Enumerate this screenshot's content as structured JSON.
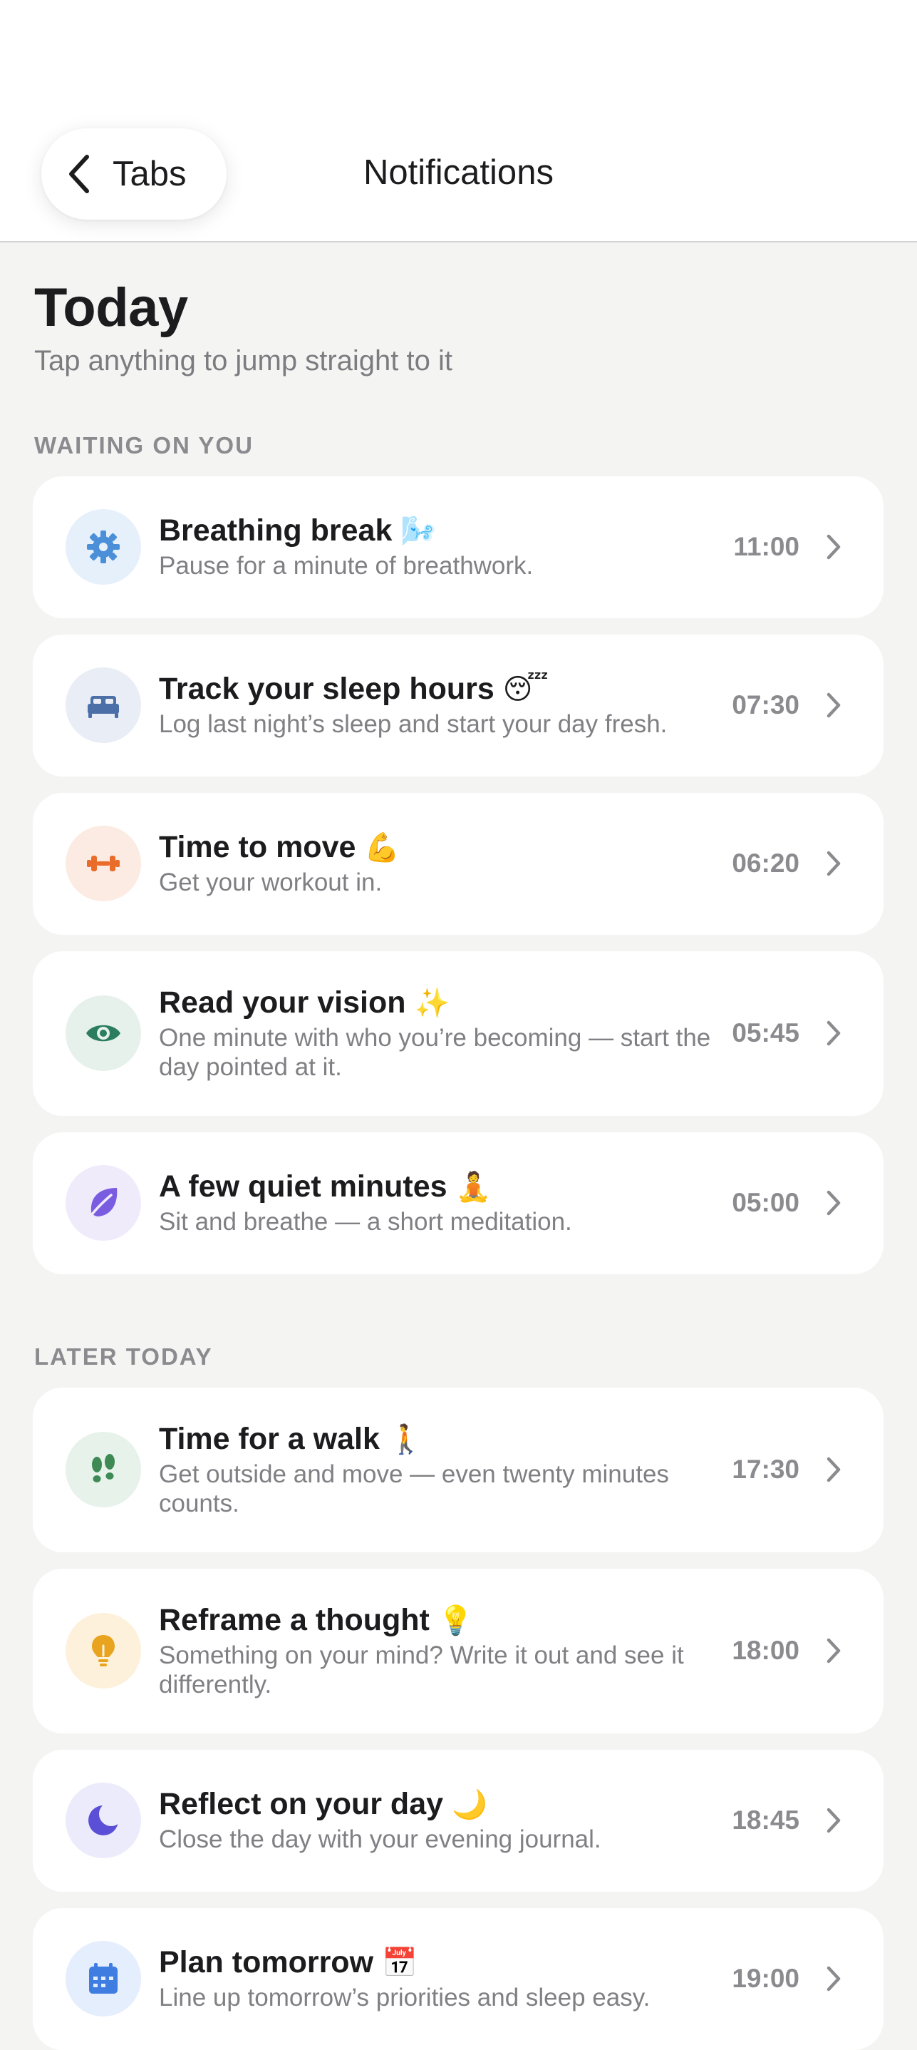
{
  "header": {
    "back_label": "Tabs",
    "title": "Notifications"
  },
  "page": {
    "heading": "Today",
    "subtitle": "Tap anything to jump straight to it"
  },
  "sections": [
    {
      "label": "WAITING ON YOU"
    },
    {
      "label": "LATER TODAY"
    }
  ],
  "colors": {
    "accent_blue": "#4a8fd8",
    "time_gray": "#8b8b8f",
    "background": "#f4f4f3"
  },
  "items": [
    {
      "title": "Breathing break",
      "emoji": "🌬️",
      "desc": "Pause for a minute of breathwork.",
      "time": "11:00",
      "icon": "gear-icon",
      "icon_color": "#4a8fd8",
      "icon_bg": "#e6f0fb"
    },
    {
      "title": "Track your sleep hours",
      "emoji": "😴",
      "desc": "Log last night’s sleep and start your day fresh.",
      "time": "07:30",
      "icon": "bed-icon",
      "icon_color": "#4c6fa8",
      "icon_bg": "#e8edf6"
    },
    {
      "title": "Time to move",
      "emoji": "💪",
      "desc": "Get your workout in.",
      "time": "06:20",
      "icon": "dumbbell-icon",
      "icon_color": "#ea6c2a",
      "icon_bg": "#fcebe2"
    },
    {
      "title": "Read your vision",
      "emoji": "✨",
      "desc": "One minute with who you’re becoming — start the day pointed at it.",
      "time": "05:45",
      "icon": "eye-icon",
      "icon_color": "#2a7d5f",
      "icon_bg": "#e7f1ec"
    },
    {
      "title": "A few quiet minutes",
      "emoji": "🧘",
      "desc": "Sit and breathe — a short meditation.",
      "time": "05:00",
      "icon": "leaf-icon",
      "icon_color": "#7a5ce0",
      "icon_bg": "#efebfb"
    },
    {
      "title": "Time for a walk",
      "emoji": "🚶",
      "desc": "Get outside and move — even twenty minutes counts.",
      "time": "17:30",
      "icon": "footprints-icon",
      "icon_color": "#3e8a55",
      "icon_bg": "#e6f2ea"
    },
    {
      "title": "Reframe a thought",
      "emoji": "💡",
      "desc": "Something on your mind? Write it out and see it differently.",
      "time": "18:00",
      "icon": "lightbulb-icon",
      "icon_color": "#e9a41f",
      "icon_bg": "#fdf1dc"
    },
    {
      "title": "Reflect on your day",
      "emoji": "🌙",
      "desc": "Close the day with your evening journal.",
      "time": "18:45",
      "icon": "moon-icon",
      "icon_color": "#5a4fd6",
      "icon_bg": "#ecebfb"
    },
    {
      "title": "Plan tomorrow",
      "emoji": "📅",
      "desc": "Line up tomorrow’s priorities and sleep easy.",
      "time": "19:00",
      "icon": "calendar-icon",
      "icon_color": "#3f7de0",
      "icon_bg": "#e5eefc"
    }
  ]
}
